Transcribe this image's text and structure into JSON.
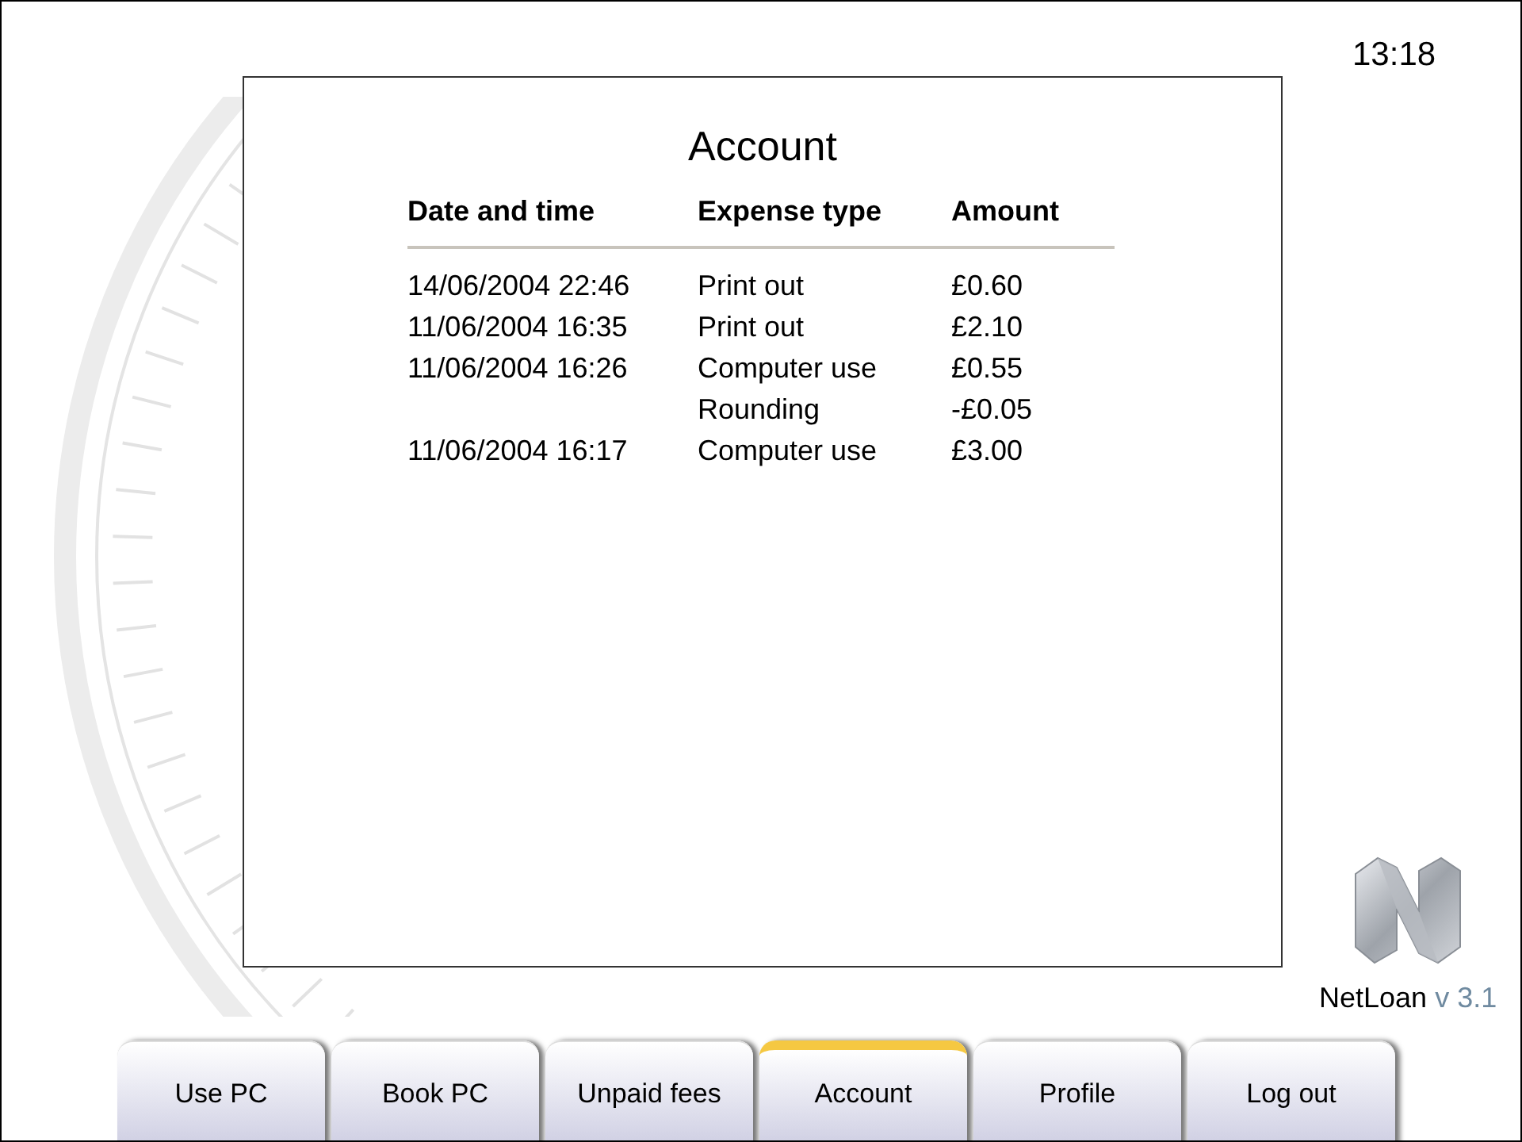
{
  "clock": "13:18",
  "panel": {
    "title": "Account",
    "table": {
      "columns": [
        "Date and time",
        "Expense type",
        "Amount"
      ],
      "rows": [
        {
          "date": "14/06/2004 22:46",
          "type": "Print out",
          "amount": "£0.60"
        },
        {
          "date": "11/06/2004 16:35",
          "type": "Print out",
          "amount": "£2.10"
        },
        {
          "date": "11/06/2004 16:26",
          "type": "Computer use",
          "amount": "£0.55"
        },
        {
          "type": "Rounding",
          "amount": "-£0.05"
        },
        {
          "date": "11/06/2004 16:17",
          "type": "Computer use",
          "amount": "£3.00"
        }
      ]
    }
  },
  "brand": {
    "name": "NetLoan",
    "version": "v 3.1"
  },
  "tabs": [
    {
      "label": "Use PC",
      "selected": false
    },
    {
      "label": "Book PC",
      "selected": false
    },
    {
      "label": "Unpaid fees",
      "selected": false
    },
    {
      "label": "Account",
      "selected": true
    },
    {
      "label": "Profile",
      "selected": false
    },
    {
      "label": "Log out",
      "selected": false
    }
  ]
}
